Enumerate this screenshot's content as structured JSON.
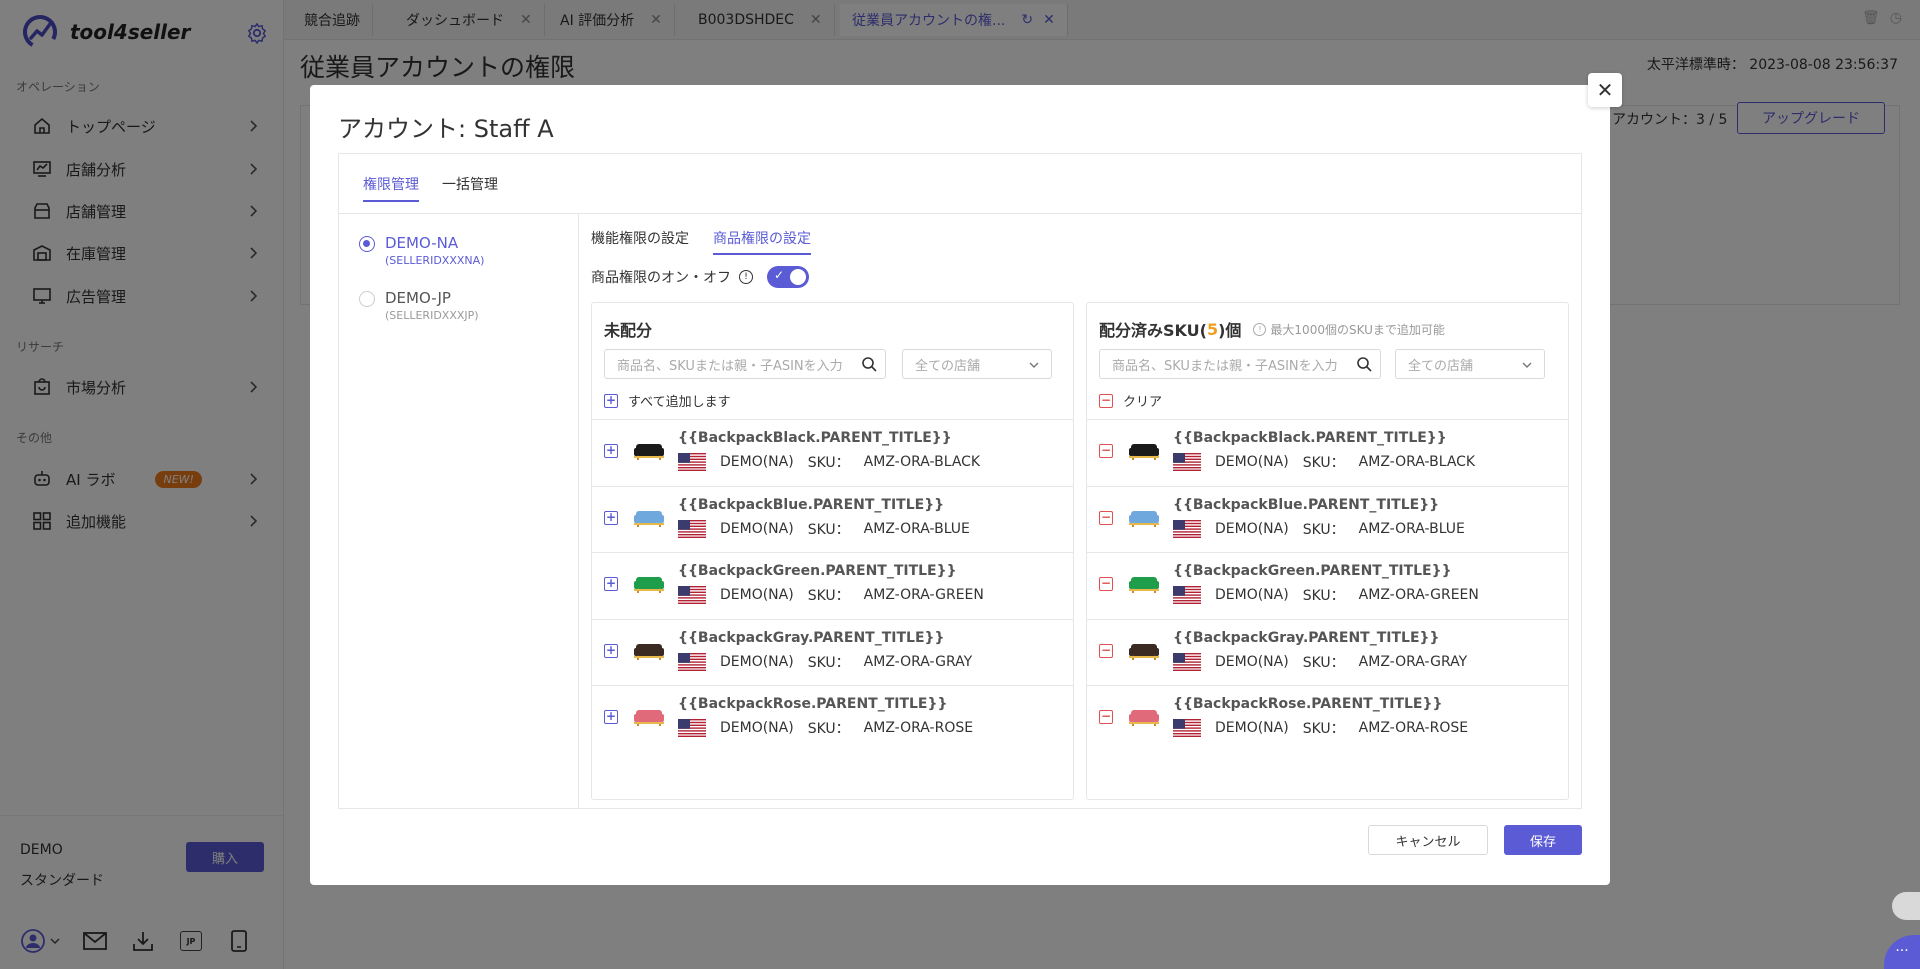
{
  "brand": {
    "name": "tool4seller"
  },
  "sidebar": {
    "sections": [
      {
        "label": "オペレーション"
      },
      {
        "label": "リサーチ"
      },
      {
        "label": "その他"
      }
    ],
    "items": [
      {
        "label": "トップページ",
        "icon": "home-icon"
      },
      {
        "label": "店舗分析",
        "icon": "analytics-icon"
      },
      {
        "label": "店舗管理",
        "icon": "store-icon"
      },
      {
        "label": "在庫管理",
        "icon": "inventory-icon"
      },
      {
        "label": "広告管理",
        "icon": "monitor-icon"
      },
      {
        "label": "市場分析",
        "icon": "market-icon"
      },
      {
        "label": "AI ラボ",
        "icon": "robot-icon",
        "badge": "NEW!"
      },
      {
        "label": "追加機能",
        "icon": "apps-icon"
      }
    ],
    "plan": {
      "name": "DEMO",
      "level": "スタンダード",
      "buy_label": "購入"
    }
  },
  "tabs": [
    {
      "label": "競合追跡"
    },
    {
      "label": "ダッシュボード"
    },
    {
      "label": "AI 評価分析"
    },
    {
      "label": "B003DSHDEC"
    },
    {
      "label": "従業員アカウントの権..."
    }
  ],
  "page": {
    "title": "従業員アカウントの権限",
    "timezone_label": "太平洋標準時：",
    "timezone_value": "2023-08-08 23:56:37",
    "account_count": "アカウント：3 / 5",
    "upgrade_label": "アップグレード"
  },
  "modal": {
    "title_prefix": "アカウント: ",
    "account_name": "Staff A",
    "tabs": [
      {
        "label": "権限管理"
      },
      {
        "label": "一括管理"
      }
    ],
    "accounts": [
      {
        "name": "DEMO-NA",
        "id": "(SELLERIDXXXNA)"
      },
      {
        "name": "DEMO-JP",
        "id": "(SELLERIDXXXJP)"
      }
    ],
    "sub_tabs": [
      {
        "label": "機能権限の設定"
      },
      {
        "label": "商品権限の設定"
      }
    ],
    "toggle_label": "商品権限のオン・オフ",
    "left_panel": {
      "title": "未配分",
      "search_placeholder": "商品名、SKUまたは親・子ASINを入力",
      "shop_select": "全ての店舗",
      "bulk_label": "すべて追加します"
    },
    "right_panel": {
      "title_prefix": "配分済みSKU(",
      "count": "5",
      "title_suffix": ")個",
      "hint": "最大1000個のSKUまで追加可能",
      "search_placeholder": "商品名、SKUまたは親・子ASINを入力",
      "shop_select": "全ての店舗",
      "bulk_label": "クリア"
    },
    "products": [
      {
        "title": "{{BackpackBlack.PARENT_TITLE}}",
        "store": "DEMO(NA)",
        "sku_label": "SKU：",
        "sku": "AMZ-ORA-BLACK",
        "color": "#1a1a1a"
      },
      {
        "title": "{{BackpackBlue.PARENT_TITLE}}",
        "store": "DEMO(NA)",
        "sku_label": "SKU：",
        "sku": "AMZ-ORA-BLUE",
        "color": "#6fa8dc"
      },
      {
        "title": "{{BackpackGreen.PARENT_TITLE}}",
        "store": "DEMO(NA)",
        "sku_label": "SKU：",
        "sku": "AMZ-ORA-GREEN",
        "color": "#1e9e4a"
      },
      {
        "title": "{{BackpackGray.PARENT_TITLE}}",
        "store": "DEMO(NA)",
        "sku_label": "SKU：",
        "sku": "AMZ-ORA-GRAY",
        "color": "#3a2a22"
      },
      {
        "title": "{{BackpackRose.PARENT_TITLE}}",
        "store": "DEMO(NA)",
        "sku_label": "SKU：",
        "sku": "AMZ-ORA-ROSE",
        "color": "#e06a7a"
      }
    ],
    "cancel_label": "キャンセル",
    "save_label": "保存"
  },
  "colors": {
    "accent": "#5b5bd6",
    "badge": "#f07a1a",
    "count": "#f0a020",
    "remove": "#e05050"
  }
}
